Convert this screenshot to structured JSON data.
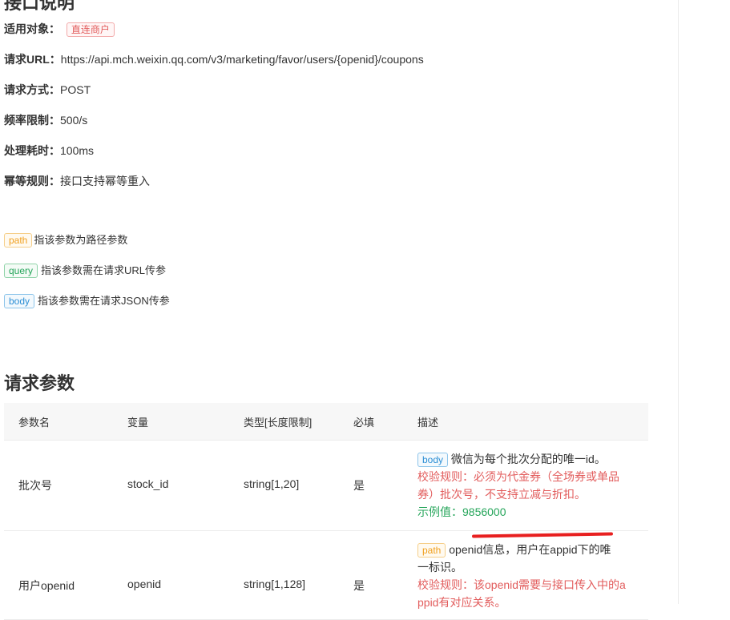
{
  "header": {
    "partial_title": "接口说明"
  },
  "info": [
    {
      "key": "适用对象：",
      "tag": "直连商户"
    },
    {
      "key": "请求URL：",
      "value": "https://api.mch.weixin.qq.com/v3/marketing/favor/users/{openid}/coupons"
    },
    {
      "key": "请求方式：",
      "value": "POST"
    },
    {
      "key": "频率限制：",
      "value": "500/s"
    },
    {
      "key": "处理耗时：",
      "value": "100ms"
    },
    {
      "key": "幂等规则：",
      "value": "接口支持幂等重入"
    }
  ],
  "legend": [
    {
      "tag": "path",
      "text": "指该参数为路径参数"
    },
    {
      "tag": "query",
      "text": "指该参数需在请求URL传参"
    },
    {
      "tag": "body",
      "text": "指该参数需在请求JSON传参"
    }
  ],
  "section": {
    "title": "请求参数"
  },
  "table": {
    "headers": [
      "参数名",
      "变量",
      "类型[长度限制]",
      "必填",
      "描述"
    ],
    "rows": [
      {
        "name": "批次号",
        "variable": "stock_id",
        "type": "string[1,20]",
        "required": "是",
        "tag": "body",
        "desc": "微信为每个批次分配的唯一id。",
        "rule_line1": "校验规则：必须为代金券（全场券或单品",
        "rule_line2": "券）批次号，不支持立减与折扣。",
        "example": "示例值：9856000"
      },
      {
        "name": "用户openid",
        "variable": "openid",
        "type": "string[1,128]",
        "required": "是",
        "tag": "path",
        "desc_line1": "openid信息，用户在appid下的唯",
        "desc_line2": "一标识。",
        "rule_line1": "校验规则：该openid需要与接口传入中的a",
        "rule_line2": "ppid有对应关系。"
      }
    ]
  },
  "colors": {
    "red": "#e25c5c",
    "green": "#25a55a",
    "blue": "#2d8fd5",
    "orange": "#f0a020",
    "annotation": "#e82020"
  }
}
